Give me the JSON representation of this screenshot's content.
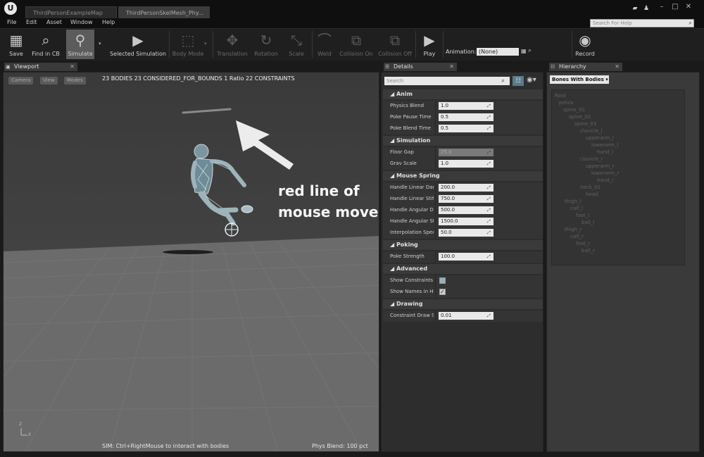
{
  "titlebar": {
    "tabs": [
      "ThirdPersonExampleMap",
      "ThirdPersonSkelMesh_Phy..."
    ],
    "help_search_placeholder": "Search For Help"
  },
  "menu": [
    "File",
    "Edit",
    "Asset",
    "Window",
    "Help"
  ],
  "toolbar": {
    "save": "Save",
    "find_in_cb": "Find in CB",
    "simulate": "Simulate",
    "selected_simulation": "Selected Simulation",
    "body_mode": "Body Mode",
    "translation": "Translation",
    "rotation": "Rotation",
    "scale": "Scale",
    "weld": "Weld",
    "collision_on": "Collision On",
    "collision_off": "Collision Off",
    "play": "Play",
    "animation_label": "Animation:",
    "animation_value": "(None)",
    "record": "Record"
  },
  "viewport": {
    "tab": "Viewport",
    "buttons": [
      "Camera",
      "View",
      "Modes"
    ],
    "stats": "23 BODIES  23 CONSIDERED_FOR_BOUNDS  1 Ratio  22 CONSTRAINTS",
    "annotation_line1": "red line of",
    "annotation_line2": "mouse move!",
    "hint": "SIM: Ctrl+RightMouse to interact with bodies",
    "phys_blend": "Phys Blend: 100 pct",
    "axis_z": "Z",
    "axis_x": "X"
  },
  "details": {
    "tab": "Details",
    "search_placeholder": "Search",
    "anim": {
      "title": "Anim",
      "rows": [
        {
          "label": "Physics Blend",
          "value": "1.0"
        },
        {
          "label": "Poke Pause Time",
          "value": "0.5"
        },
        {
          "label": "Poke Blend Time",
          "value": "0.5"
        }
      ]
    },
    "simulation": {
      "title": "Simulation",
      "rows": [
        {
          "label": "Floor Gap",
          "value": "25.0"
        },
        {
          "label": "Grav Scale",
          "value": "1.0"
        }
      ]
    },
    "mouse_spring": {
      "title": "Mouse Spring",
      "rows": [
        {
          "label": "Handle Linear Dan",
          "value": "200.0"
        },
        {
          "label": "Handle Linear Stif",
          "value": "750.0"
        },
        {
          "label": "Handle Angular Da",
          "value": "500.0"
        },
        {
          "label": "Handle Angular St",
          "value": "1500.0"
        },
        {
          "label": "Interpolation Spee",
          "value": "50.0"
        }
      ]
    },
    "poking": {
      "title": "Poking",
      "rows": [
        {
          "label": "Poke Strength",
          "value": "100.0"
        }
      ]
    },
    "advanced": {
      "title": "Advanced",
      "rows": [
        {
          "label": "Show Constraints"
        },
        {
          "label": "Show Names in HI"
        }
      ]
    },
    "drawing": {
      "title": "Drawing",
      "rows": [
        {
          "label": "Constraint Draw S",
          "value": "0.01"
        }
      ]
    }
  },
  "hierarchy": {
    "tab": "Hierarchy",
    "filter": "Bones With Bodies",
    "bones": [
      "Root",
      "pelvis",
      "spine_01",
      "spine_02",
      "spine_03",
      "clavicle_l",
      "upperarm_l",
      "lowerarm_l",
      "hand_l",
      "clavicle_r",
      "upperarm_r",
      "lowerarm_r",
      "hand_r",
      "neck_01",
      "head",
      "thigh_l",
      "calf_l",
      "foot_l",
      "ball_l",
      "thigh_r",
      "calf_r",
      "foot_r",
      "ball_r"
    ]
  }
}
